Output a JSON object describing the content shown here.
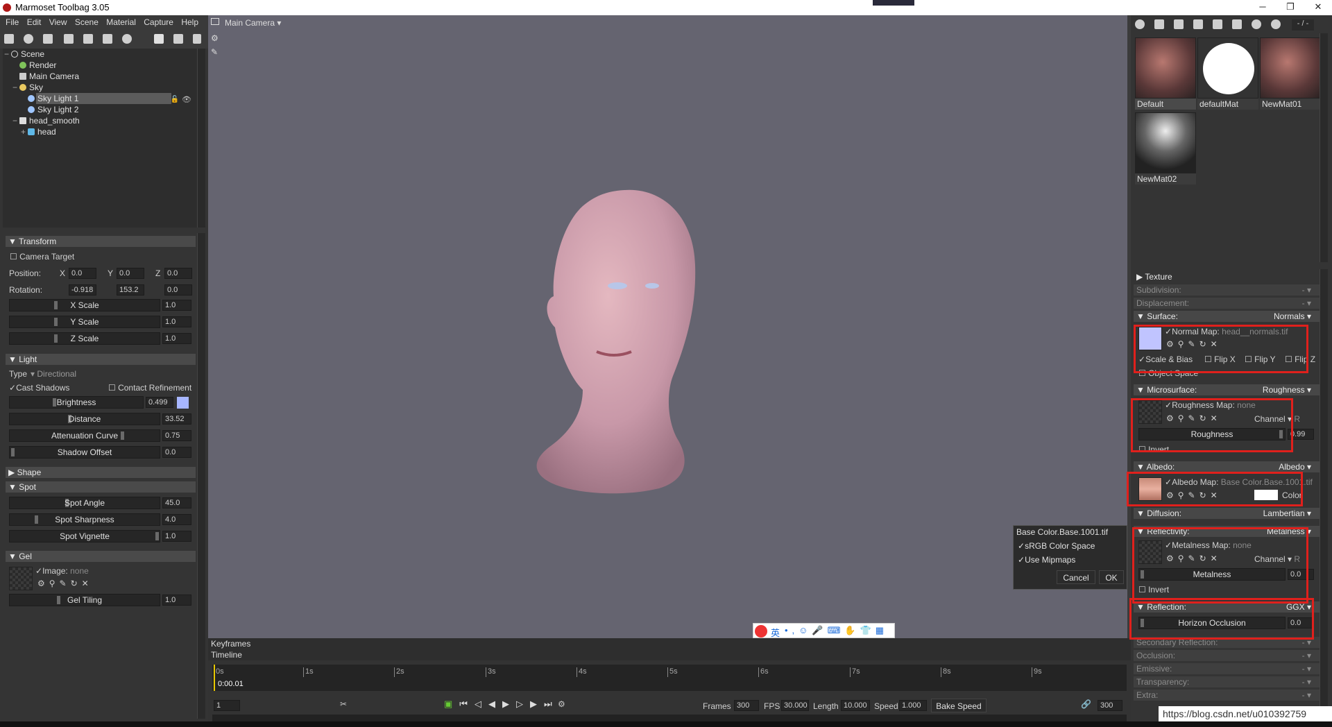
{
  "window": {
    "title": "Marmoset Toolbag 3.05"
  },
  "menu": [
    "File",
    "Edit",
    "View",
    "Scene",
    "Material",
    "Capture",
    "Help"
  ],
  "outliner": {
    "items": [
      {
        "label": "Scene"
      },
      {
        "label": "Render"
      },
      {
        "label": "Main Camera"
      },
      {
        "label": "Sky"
      },
      {
        "label": "Sky Light 1"
      },
      {
        "label": "Sky Light 2"
      },
      {
        "label": "head_smooth"
      },
      {
        "label": "head"
      }
    ]
  },
  "transform": {
    "title": "Transform",
    "camera_target": "Camera Target",
    "position_label": "Position:",
    "rotation_label": "Rotation:",
    "x": "X",
    "y": "Y",
    "z": "Z",
    "pos": [
      "0.0",
      "0.0",
      "0.0"
    ],
    "rot": [
      "-0.918",
      "153.2",
      "0.0"
    ],
    "xscale": "X Scale",
    "yscale": "Y Scale",
    "zscale": "Z Scale",
    "scale_vals": [
      "1.0",
      "1.0",
      "1.0"
    ]
  },
  "light": {
    "title": "Light",
    "type_label": "Type",
    "type_value": "Directional",
    "cast_shadows": "Cast Shadows",
    "contact": "Contact Refinement",
    "brightness": "Brightness",
    "brightness_val": "0.499",
    "distance": "Distance",
    "distance_val": "33.52",
    "atten": "Attenuation Curve",
    "atten_val": "0.75",
    "shadow_offset": "Shadow Offset",
    "shadow_offset_val": "0.0"
  },
  "shape": {
    "title": "Shape"
  },
  "spot": {
    "title": "Spot",
    "angle": "Spot Angle",
    "angle_val": "45.0",
    "sharp": "Spot Sharpness",
    "sharp_val": "4.0",
    "vign": "Spot Vignette",
    "vign_val": "1.0"
  },
  "gel": {
    "title": "Gel",
    "image_label": "Image:",
    "image_val": "none",
    "tiling": "Gel Tiling",
    "tiling_val": "1.0"
  },
  "viewport": {
    "camera": "Main Camera"
  },
  "timeline": {
    "keyframes": "Keyframes",
    "timeline": "Timeline",
    "time": "0:00.01",
    "ticks": [
      "0s",
      "1s",
      "2s",
      "3s",
      "4s",
      "5s",
      "6s",
      "7s",
      "8s",
      "9s"
    ],
    "frame": "1",
    "frames_label": "Frames",
    "frames_val": "300",
    "fps_label": "FPS",
    "fps_val": "30.000",
    "length_label": "Length",
    "length_val": "10.000",
    "speed_label": "Speed",
    "speed_val": "1.000",
    "bake": "Bake Speed",
    "end_val": "300"
  },
  "materials": {
    "page": "- / -",
    "items": [
      {
        "label": "Default"
      },
      {
        "label": "defaultMat"
      },
      {
        "label": "NewMat01"
      },
      {
        "label": "NewMat02"
      }
    ]
  },
  "props": {
    "texture": "Texture",
    "subdivision": "Subdivision:",
    "displacement": "Displacement:",
    "dash": "-",
    "surface": "Surface:",
    "surface_val": "Normals",
    "normal_map": "Normal Map:",
    "normal_file": "head__normals.tif",
    "scale_bias": "Scale & Bias",
    "flipx": "Flip X",
    "flipy": "Flip Y",
    "flipz": "Flip Z",
    "object_space": "Object Space",
    "micro": "Microsurface:",
    "micro_val": "Roughness",
    "rough_map": "Roughness Map:",
    "rough_file": "none",
    "channel": "Channel",
    "channel_r": "R",
    "roughness": "Roughness",
    "rough_val": "0.99",
    "invert": "Invert",
    "albedo": "Albedo:",
    "albedo_val": "Albedo",
    "albedo_map": "Albedo Map:",
    "albedo_file": "Base Color.Base.1001.tif",
    "color": "Color",
    "diffusion": "Diffusion:",
    "diffusion_val": "Lambertian",
    "reflectivity": "Reflectivity:",
    "reflectivity_val": "Metalness",
    "metal_map": "Metalness Map:",
    "metal_file": "none",
    "metalness": "Metalness",
    "metal_val": "0.0",
    "reflection": "Reflection:",
    "reflection_val": "GGX",
    "horizon": "Horizon Occlusion",
    "horizon_val": "0.0",
    "secondary": "Secondary Reflection:",
    "occlusion": "Occlusion:",
    "emissive": "Emissive:",
    "transparency": "Transparency:",
    "extra": "Extra:"
  },
  "dialog": {
    "title": "Base Color.Base.1001.tif",
    "srgb": "sRGB Color Space",
    "mipmaps": "Use Mipmaps",
    "cancel": "Cancel",
    "ok": "OK"
  },
  "ime": {
    "lang": "英"
  },
  "status": {
    "url": "https://blog.csdn.net/u010392759"
  }
}
